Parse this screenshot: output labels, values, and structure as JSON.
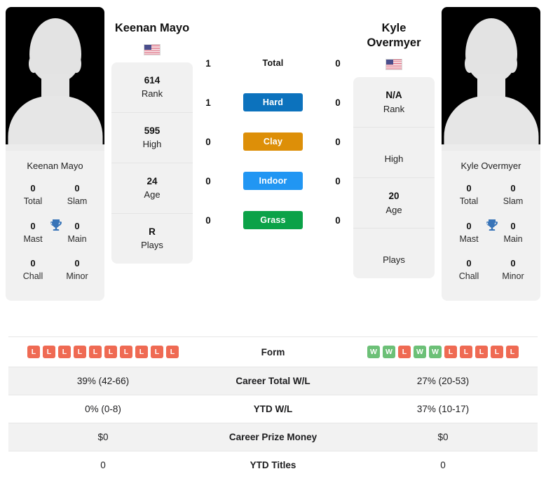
{
  "players": {
    "left": {
      "name": "Keenan Mayo",
      "card_name": "Keenan Mayo",
      "flag": "us-flag-icon",
      "rank": "614",
      "rank_label": "Rank",
      "high": "595",
      "high_label": "High",
      "age": "24",
      "age_label": "Age",
      "plays": "R",
      "plays_label": "Plays",
      "titles": [
        {
          "value": "0",
          "label": "Total"
        },
        {
          "value": "0",
          "label": "Slam"
        },
        {
          "value": "0",
          "label": "Mast"
        },
        {
          "value": "0",
          "label": "Main"
        },
        {
          "value": "0",
          "label": "Chall"
        },
        {
          "value": "0",
          "label": "Minor"
        }
      ]
    },
    "right": {
      "name": "Kyle Overmyer",
      "card_name": "Kyle Overmyer",
      "flag": "us-flag-icon",
      "rank": "N/A",
      "rank_label": "Rank",
      "high": "",
      "high_label": "High",
      "age": "20",
      "age_label": "Age",
      "plays": "",
      "plays_label": "Plays",
      "titles": [
        {
          "value": "0",
          "label": "Total"
        },
        {
          "value": "0",
          "label": "Slam"
        },
        {
          "value": "0",
          "label": "Mast"
        },
        {
          "value": "0",
          "label": "Main"
        },
        {
          "value": "0",
          "label": "Chall"
        },
        {
          "value": "0",
          "label": "Minor"
        }
      ]
    }
  },
  "h2h": {
    "rows": [
      {
        "label": "Total",
        "left": "1",
        "right": "0",
        "color": "",
        "plain": true
      },
      {
        "label": "Hard",
        "left": "1",
        "right": "0",
        "color": "#0c72bd",
        "plain": false
      },
      {
        "label": "Clay",
        "left": "0",
        "right": "0",
        "color": "#dd8f08",
        "plain": false
      },
      {
        "label": "Indoor",
        "left": "0",
        "right": "0",
        "color": "#2196f3",
        "plain": false
      },
      {
        "label": "Grass",
        "left": "0",
        "right": "0",
        "color": "#0ba248",
        "plain": false
      }
    ]
  },
  "table": {
    "form": {
      "label": "Form",
      "left": [
        "L",
        "L",
        "L",
        "L",
        "L",
        "L",
        "L",
        "L",
        "L",
        "L"
      ],
      "right": [
        "W",
        "W",
        "L",
        "W",
        "W",
        "L",
        "L",
        "L",
        "L",
        "L"
      ]
    },
    "rows": [
      {
        "label": "Career Total W/L",
        "left": "39% (42-66)",
        "right": "27% (20-53)"
      },
      {
        "label": "YTD W/L",
        "left": "0% (0-8)",
        "right": "37% (10-17)"
      },
      {
        "label": "Career Prize Money",
        "left": "$0",
        "right": "$0"
      },
      {
        "label": "YTD Titles",
        "left": "0",
        "right": "0"
      }
    ]
  },
  "colors": {
    "win": "#6cc077",
    "loss": "#ef6a53",
    "trophy": "#3874b8",
    "card_bg": "#f1f1f1"
  }
}
